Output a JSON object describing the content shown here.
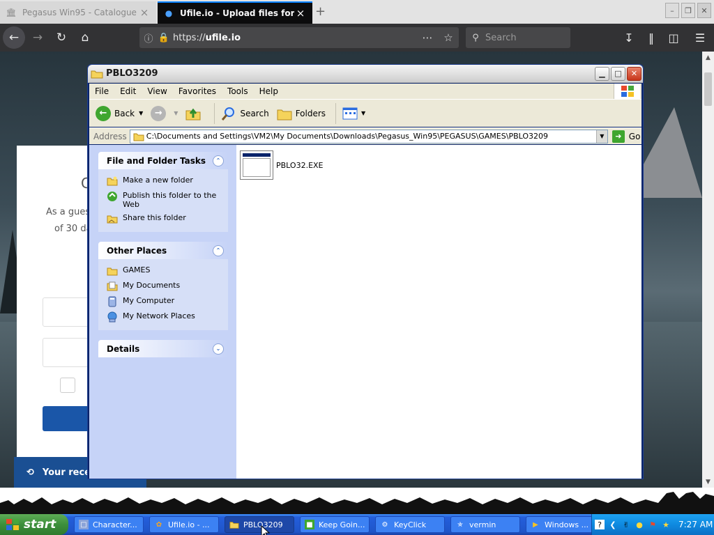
{
  "browser": {
    "tabs": [
      {
        "title": "Pegasus Win95 - Catalogue"
      },
      {
        "title": "Ufile.io - Upload files for free & share"
      }
    ],
    "url_prefix": "https://",
    "url_domain": "ufile.io",
    "search_placeholder": "Search"
  },
  "webpage": {
    "headline": "C",
    "line1": "As a gues",
    "line2": "of 30 da",
    "recent_label": "Your recen"
  },
  "explorer": {
    "title": "PBLO3209",
    "menu": [
      "File",
      "Edit",
      "View",
      "Favorites",
      "Tools",
      "Help"
    ],
    "toolbar": {
      "back": "Back",
      "search": "Search",
      "folders": "Folders"
    },
    "address_label": "Address",
    "address_path": "C:\\Documents and Settings\\VM2\\My Documents\\Downloads\\Pegasus_Win95\\PEGASUS\\GAMES\\PBLO3209",
    "go_label": "Go",
    "panels": {
      "tasks_title": "File and Folder Tasks",
      "tasks": [
        "Make a new folder",
        "Publish this folder to the Web",
        "Share this folder"
      ],
      "places_title": "Other Places",
      "places": [
        "GAMES",
        "My Documents",
        "My Computer",
        "My Network Places"
      ],
      "details_title": "Details"
    },
    "files": [
      {
        "name": "PBLO32.EXE"
      }
    ]
  },
  "taskbar": {
    "start_label": "start",
    "tasks": [
      {
        "label": "Character...",
        "active": false
      },
      {
        "label": "Ufile.io - ...",
        "active": false
      },
      {
        "label": "PBLO3209",
        "active": true
      },
      {
        "label": "Keep Goin...",
        "active": false
      },
      {
        "label": "KeyClick",
        "active": false
      },
      {
        "label": "vermin",
        "active": false
      },
      {
        "label": "Windows ...",
        "active": false
      }
    ],
    "clock": "7:27 AM"
  },
  "colors": {
    "xp_blue": "#245edb",
    "start_green": "#3c8f3b",
    "firefox_dark": "#323234",
    "task_pane": "#c6d3f7"
  }
}
